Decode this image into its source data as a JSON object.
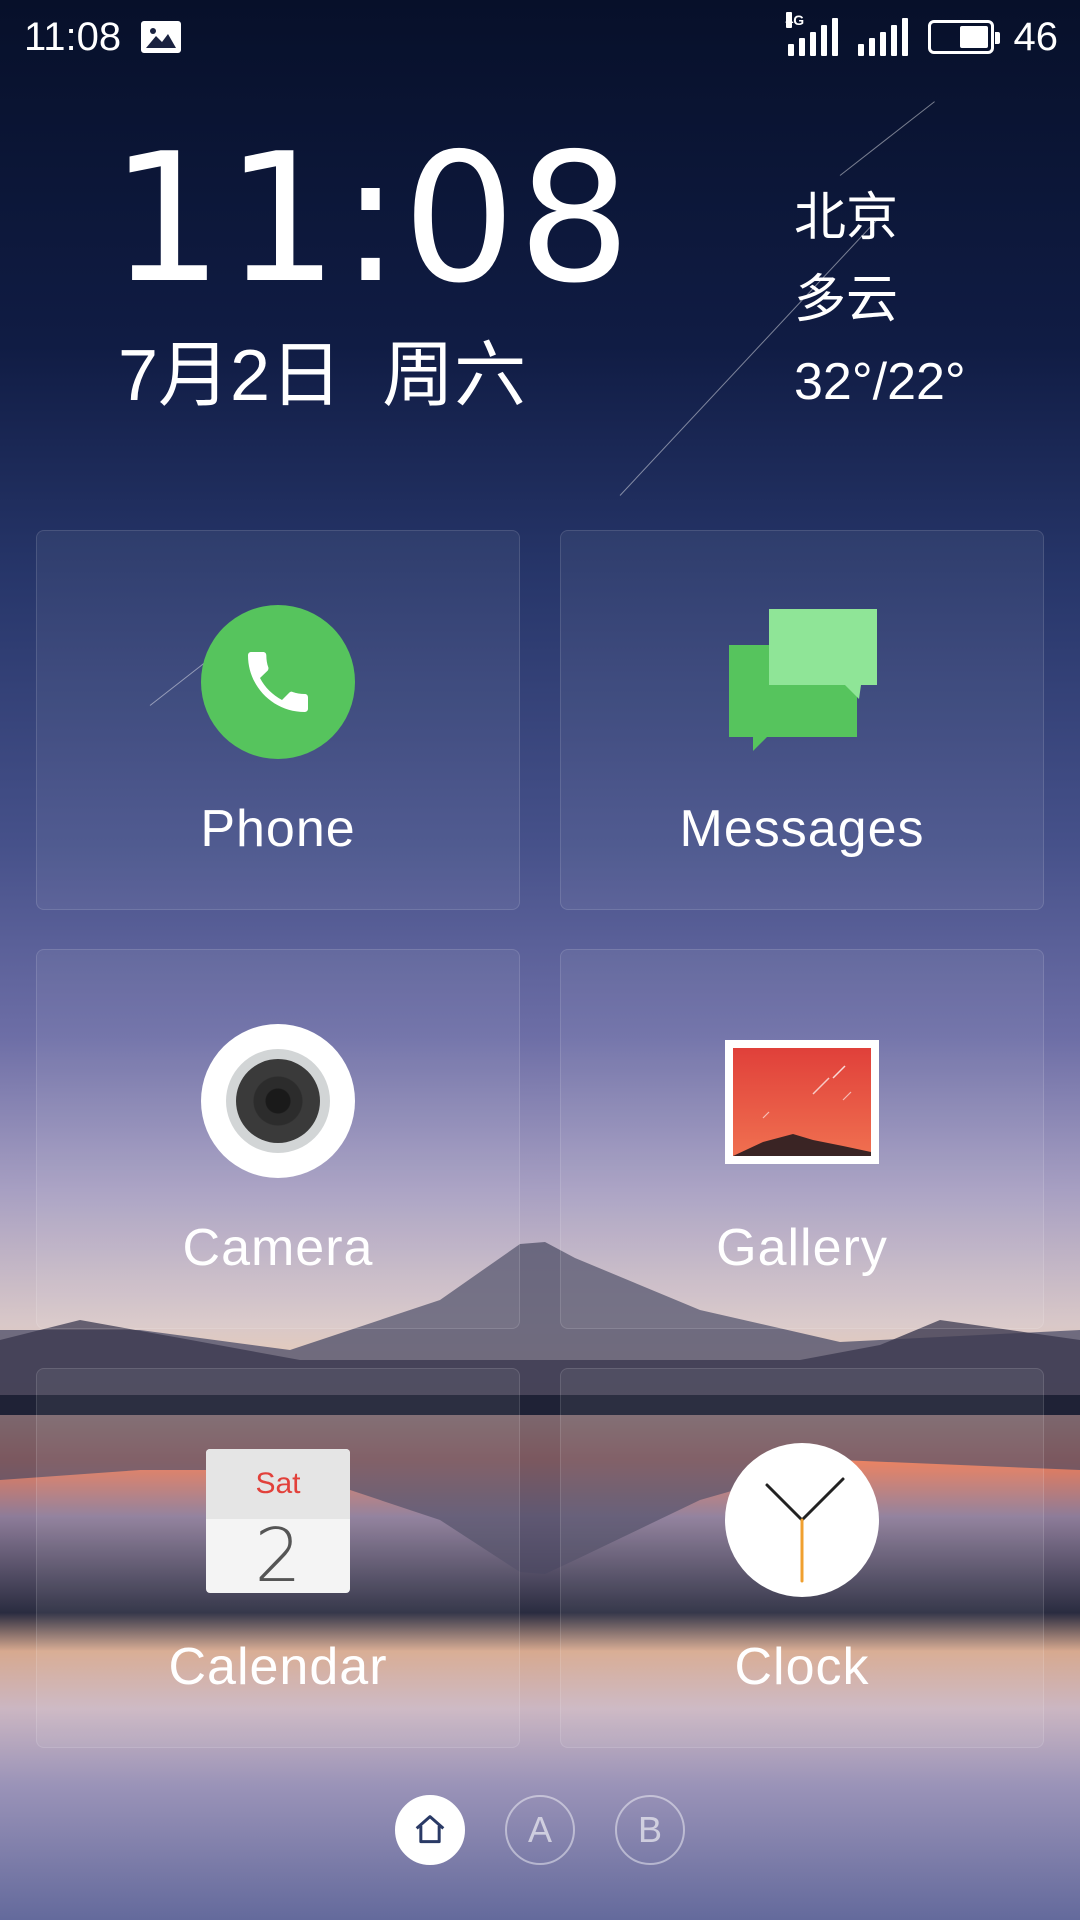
{
  "status_bar": {
    "time": "11:08",
    "network_label": "4G",
    "battery_level": "46"
  },
  "clock_widget": {
    "time": "11:08",
    "date": "7月2日  周六",
    "city": "北京",
    "condition": "多云",
    "temperature": "32°/22°"
  },
  "apps": [
    {
      "label": "Phone",
      "icon": "phone-icon"
    },
    {
      "label": "Messages",
      "icon": "messages-icon"
    },
    {
      "label": "Camera",
      "icon": "camera-icon"
    },
    {
      "label": "Gallery",
      "icon": "gallery-icon"
    },
    {
      "label": "Calendar",
      "icon": "calendar-icon"
    },
    {
      "label": "Clock",
      "icon": "clock-icon"
    }
  ],
  "calendar_icon": {
    "weekday": "Sat",
    "day": "2"
  },
  "pager": {
    "page_a": "A",
    "page_b": "B"
  },
  "colors": {
    "phone_green": "#56c45d",
    "messages_green": "#8fe597",
    "gallery_red": "#e8493e",
    "calendar_red": "#e2413b",
    "clock_hand_orange": "#f0a030"
  }
}
